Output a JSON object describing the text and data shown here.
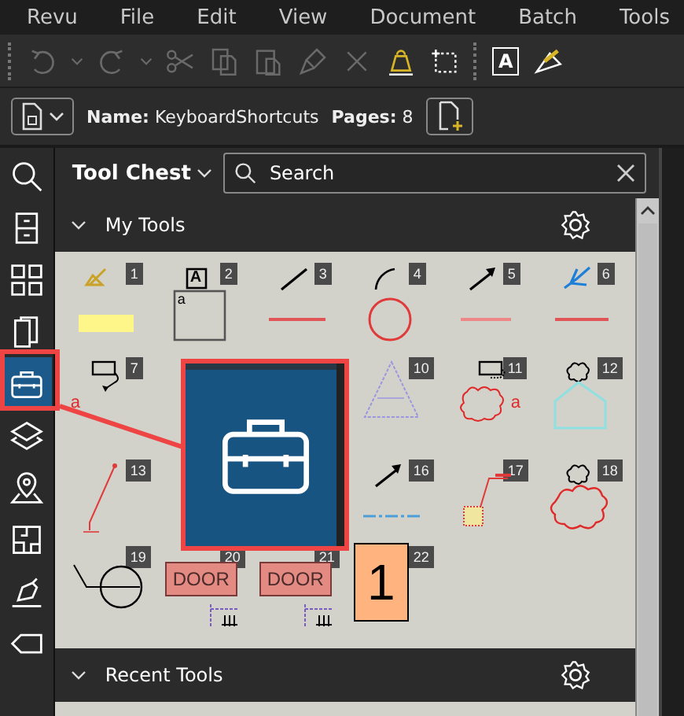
{
  "menu": [
    "Revu",
    "File",
    "Edit",
    "View",
    "Document",
    "Batch",
    "Tools"
  ],
  "toolbar": [
    {
      "kind": "undo",
      "disabled": true
    },
    {
      "kind": "caret",
      "disabled": true
    },
    {
      "kind": "redo",
      "disabled": true
    },
    {
      "kind": "caret",
      "disabled": true
    },
    {
      "kind": "scissors",
      "disabled": true
    },
    {
      "kind": "copy",
      "disabled": true
    },
    {
      "kind": "paste",
      "disabled": true
    },
    {
      "kind": "brush",
      "disabled": true
    },
    {
      "kind": "close",
      "disabled": true
    },
    {
      "kind": "weight",
      "disabled": false
    },
    {
      "kind": "select",
      "disabled": false
    },
    {
      "kind": "sep"
    },
    {
      "kind": "text",
      "disabled": false,
      "label": "A"
    },
    {
      "kind": "ruler",
      "disabled": false
    }
  ],
  "document": {
    "name_label": "Name:",
    "name": "KeyboardShortcuts",
    "pages_label": "Pages:",
    "pages": "8"
  },
  "sidebar": [
    {
      "kind": "search",
      "selected": false
    },
    {
      "kind": "cabinet",
      "selected": false
    },
    {
      "kind": "grid",
      "selected": false
    },
    {
      "kind": "book",
      "selected": false
    },
    {
      "kind": "toolbox",
      "selected": true
    },
    {
      "kind": "layers",
      "selected": false
    },
    {
      "kind": "pin",
      "selected": false
    },
    {
      "kind": "plan",
      "selected": false
    },
    {
      "kind": "pen",
      "selected": false
    },
    {
      "kind": "tag",
      "selected": false
    }
  ],
  "panel": {
    "title": "Tool Chest",
    "search": {
      "placeholder": "Search"
    }
  },
  "sections": [
    {
      "title": "My Tools",
      "expanded": true,
      "tools": [
        {
          "kind": "highlight",
          "number": "1"
        },
        {
          "kind": "text-box",
          "number": "2",
          "texts": [
            "A",
            "a"
          ]
        },
        {
          "kind": "line",
          "number": "3"
        },
        {
          "kind": "arc",
          "number": "4"
        },
        {
          "kind": "arrow",
          "number": "5"
        },
        {
          "kind": "polyline",
          "number": "6"
        },
        {
          "kind": "callout",
          "number": "7",
          "texts": [
            "a"
          ]
        },
        {
          "kind": "covered"
        },
        {
          "kind": "covered"
        },
        {
          "kind": "triangle",
          "number": "10"
        },
        {
          "kind": "cloud-callout",
          "number": "11",
          "texts": [
            "a"
          ]
        },
        {
          "kind": "pentagon",
          "number": "12"
        },
        {
          "kind": "leader",
          "number": "13"
        },
        {
          "kind": "covered"
        },
        {
          "kind": "covered"
        },
        {
          "kind": "dash-arrow",
          "number": "16"
        },
        {
          "kind": "note",
          "number": "17"
        },
        {
          "kind": "cloud",
          "number": "18"
        },
        {
          "kind": "symbol",
          "number": "19"
        },
        {
          "kind": "door",
          "number": "20",
          "texts": [
            "DOOR"
          ]
        },
        {
          "kind": "door",
          "number": "21",
          "texts": [
            "DOOR"
          ]
        },
        {
          "kind": "count",
          "number": "22",
          "texts": [
            "1"
          ]
        }
      ]
    },
    {
      "title": "Recent Tools",
      "expanded": true
    }
  ]
}
